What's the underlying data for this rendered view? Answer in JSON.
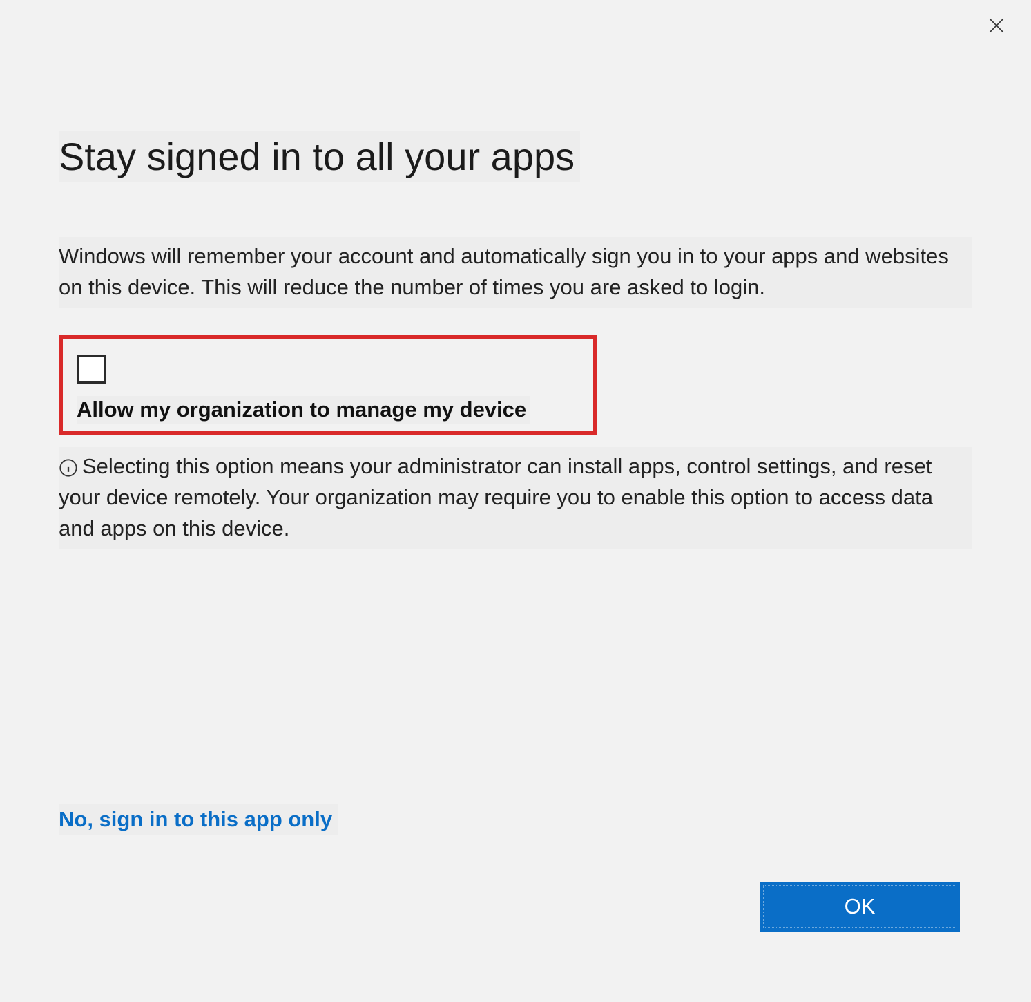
{
  "dialog": {
    "title": "Stay signed in to all your apps",
    "description": "Windows will remember your account and automatically sign you in to your apps and websites on this device. This will reduce the number of times you are asked to login.",
    "checkbox_label": "Allow my organization to manage my device",
    "checkbox_checked": false,
    "info_text": "Selecting this option means your administrator can install apps, control settings, and reset your device remotely. Your organization may require you to enable this option to access data and apps on this device.",
    "link_text": "No, sign in to this app only",
    "ok_button": "OK"
  }
}
